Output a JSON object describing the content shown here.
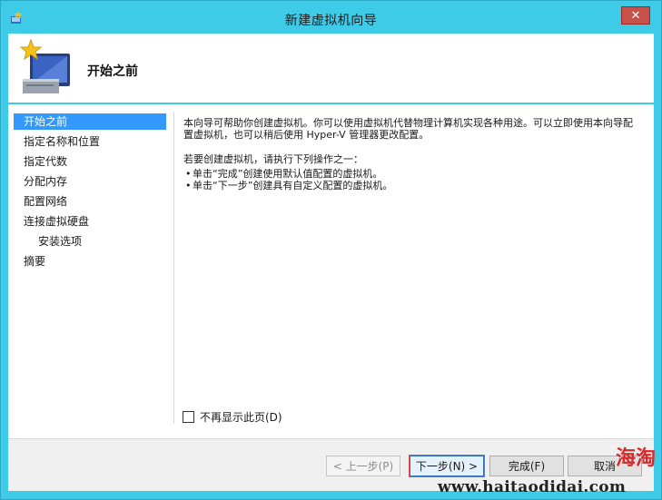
{
  "window": {
    "title": "新建虚拟机向导",
    "close_glyph": "✕",
    "accent_color": "#3dcbe8"
  },
  "header": {
    "title": "开始之前"
  },
  "nav": {
    "items": [
      {
        "label": "开始之前",
        "active": true
      },
      {
        "label": "指定名称和位置"
      },
      {
        "label": "指定代数"
      },
      {
        "label": "分配内存"
      },
      {
        "label": "配置网络"
      },
      {
        "label": "连接虚拟硬盘"
      },
      {
        "label": "安装选项",
        "sub": true
      },
      {
        "label": "摘要"
      }
    ]
  },
  "content": {
    "intro": "本向导可帮助你创建虚拟机。你可以使用虚拟机代替物理计算机实现各种用途。可以立即使用本向导配置虚拟机，也可以稍后使用 Hyper-V 管理器更改配置。",
    "instruction": "若要创建虚拟机，请执行下列操作之一：",
    "bullets": [
      "单击“完成”创建使用默认值配置的虚拟机。",
      "单击“下一步”创建具有自定义配置的虚拟机。"
    ]
  },
  "checkbox": {
    "label": "不再显示此页(D)",
    "checked": false
  },
  "buttons": {
    "prev": "< 上一步(P)",
    "next": "下一步(N) >",
    "finish": "完成(F)",
    "cancel": "取消"
  },
  "watermark": {
    "url": "www.haitaodidai.com",
    "stamp": "海淘"
  }
}
